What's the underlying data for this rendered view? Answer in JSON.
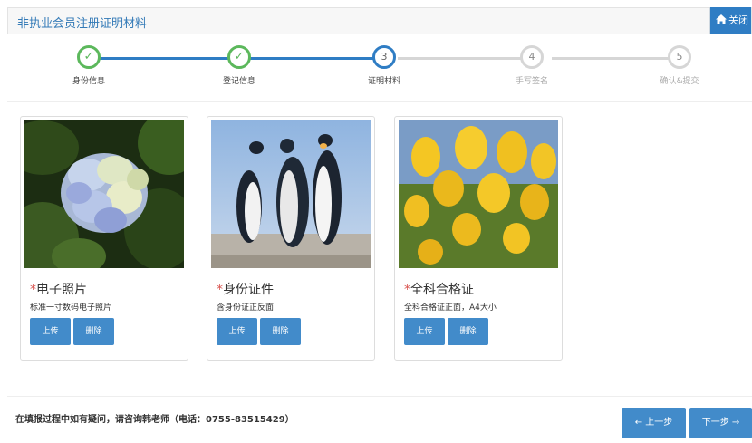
{
  "header": {
    "title": "非执业会员注册证明材料",
    "close_label": "关闭"
  },
  "steps": [
    {
      "label": "身份信息",
      "status": "done",
      "marker": "✓"
    },
    {
      "label": "登记信息",
      "status": "done",
      "marker": "✓"
    },
    {
      "label": "证明材料",
      "status": "active",
      "marker": "3"
    },
    {
      "label": "手写签名",
      "status": "todo",
      "marker": "4"
    },
    {
      "label": "确认&提交",
      "status": "todo",
      "marker": "5"
    }
  ],
  "cards": [
    {
      "required_mark": "*",
      "title": "电子照片",
      "desc": "标准一寸数码电子照片",
      "upload_label": "上传",
      "delete_label": "删除"
    },
    {
      "required_mark": "*",
      "title": "身份证件",
      "desc": "含身份证正反面",
      "upload_label": "上传",
      "delete_label": "删除"
    },
    {
      "required_mark": "*",
      "title": "全科合格证",
      "desc": "全科合格证正面，A4大小",
      "upload_label": "上传",
      "delete_label": "删除"
    }
  ],
  "footer": {
    "help_text": "在填报过程中如有疑问，请咨询韩老师（电话：0755-83515429）",
    "prev_label": "← 上一步",
    "next_label": "下一步 →"
  },
  "colors": {
    "primary": "#428bca",
    "done": "#5cb85c",
    "required": "#d9534f"
  }
}
